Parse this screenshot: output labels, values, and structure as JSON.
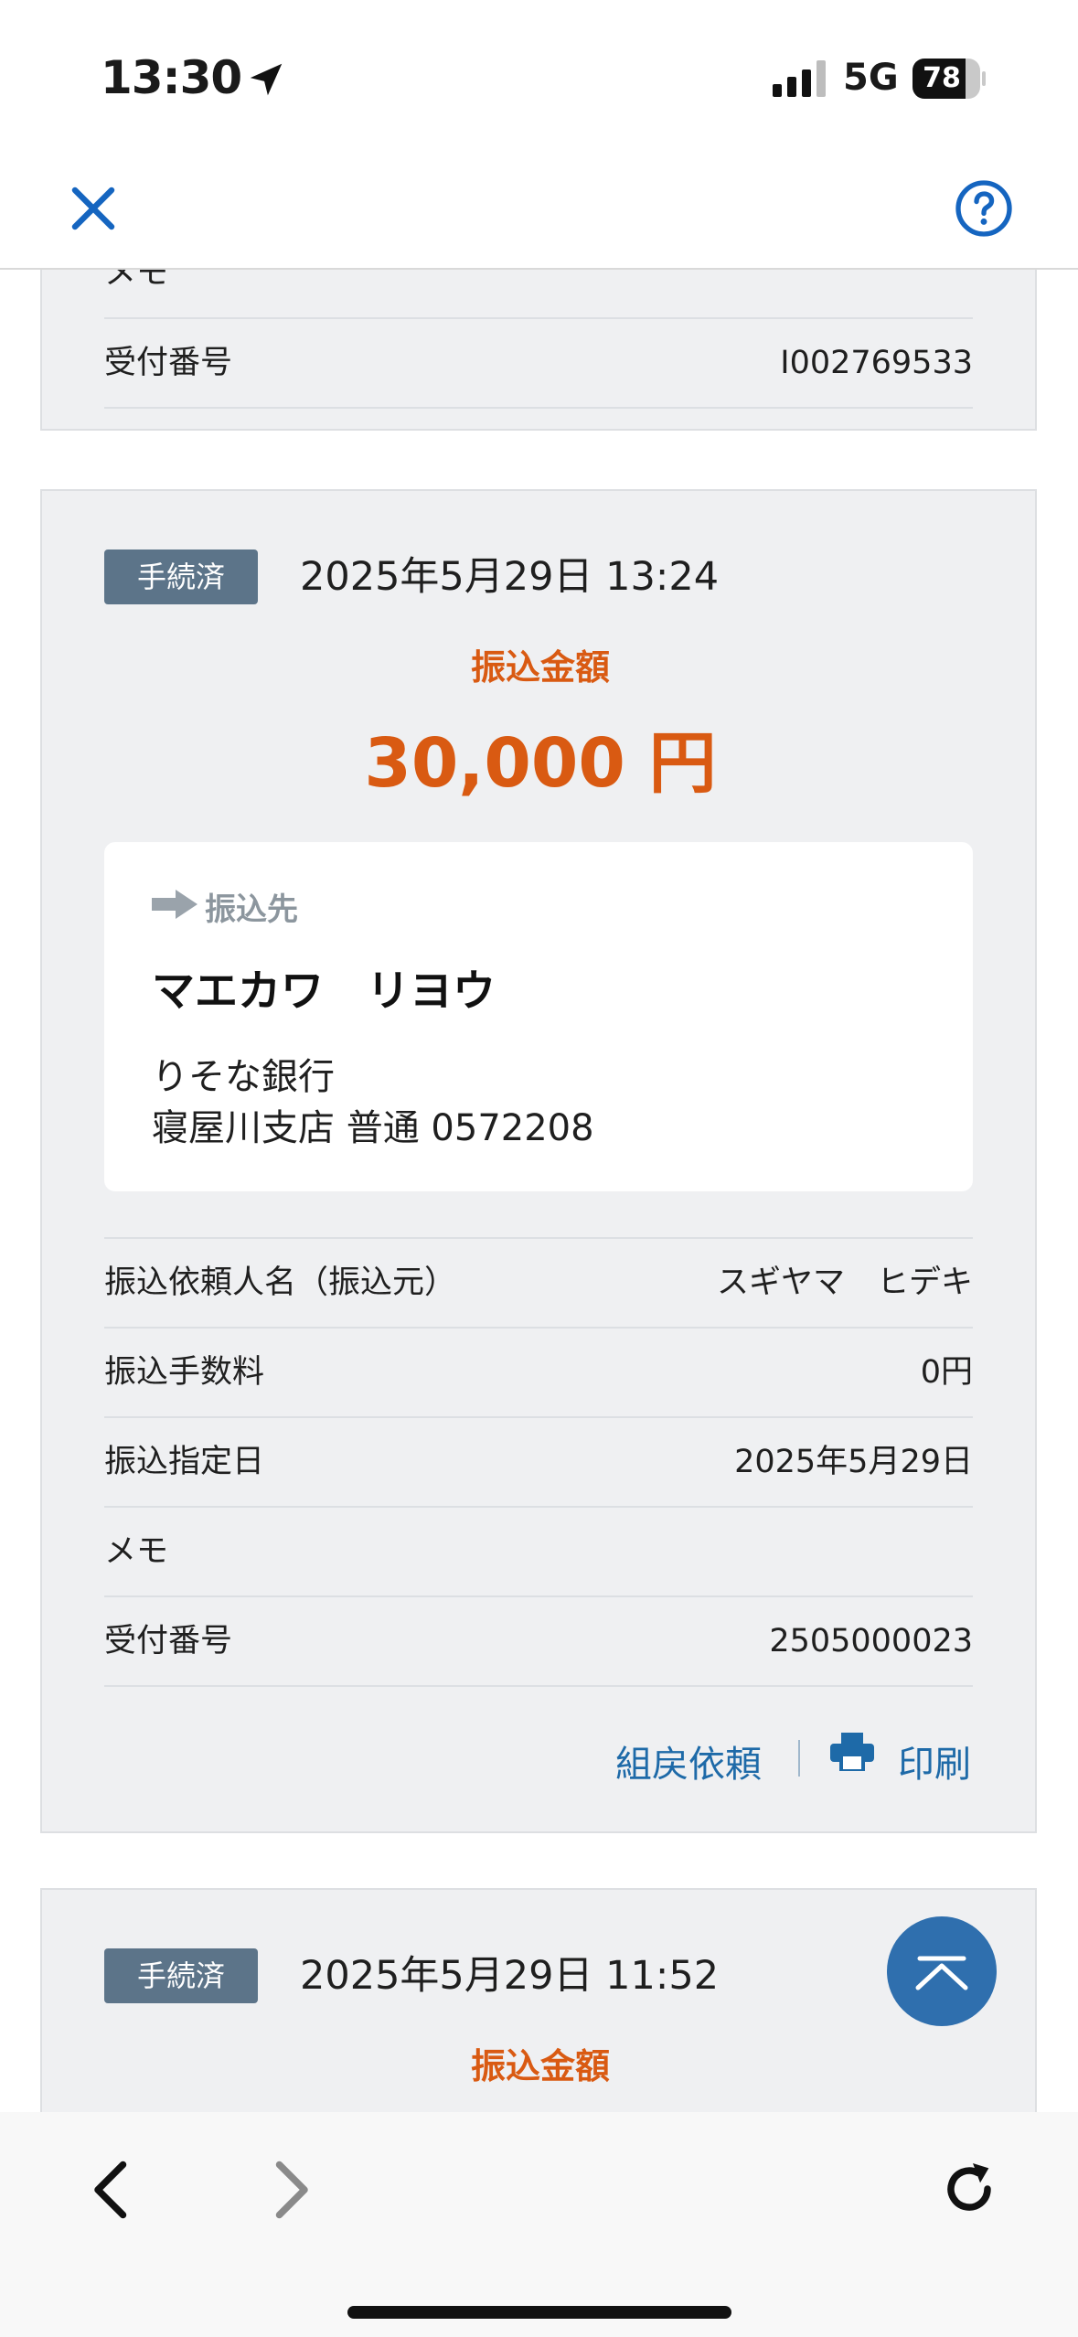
{
  "status_bar": {
    "time": "13:30",
    "network": "5G",
    "battery_percent": 78,
    "battery_label": "78",
    "location_icon": "location-arrow-icon",
    "signal_icon": "signal-bars-icon"
  },
  "header": {
    "close_icon": "close-icon",
    "help_icon": "help-circle-icon",
    "accent_color": "#1565c0"
  },
  "top_card": {
    "partial_label": "メモ",
    "receipt_label": "受付番号",
    "receipt_value": "I002769533"
  },
  "transfer_card": {
    "status_badge": "手続済",
    "datetime": "2025年5月29日 13:24",
    "amount_label": "振込金額",
    "amount": "30,000 円",
    "destination": {
      "label": "振込先",
      "name": "マエカワ　リヨウ",
      "bank": "りそな銀行",
      "branch_account": "寝屋川支店 普通 0572208"
    },
    "details": [
      {
        "label": "振込依頼人名（振込元）",
        "value": "スギヤマ　ヒデキ"
      },
      {
        "label": "振込手数料",
        "value": "0円"
      },
      {
        "label": "振込指定日",
        "value": "2025年5月29日"
      },
      {
        "label": "メモ",
        "value": ""
      },
      {
        "label": "受付番号",
        "value": "2505000023"
      }
    ],
    "actions": {
      "reassemble": "組戻依頼",
      "print": "印刷"
    }
  },
  "next_card": {
    "status_badge": "手続済",
    "datetime": "2025年5月29日 11:52",
    "amount_label": "振込金額"
  },
  "scroll_top_icon": "chevron-up-icon",
  "toolbar": {
    "back_icon": "chevron-left-icon",
    "forward_icon": "chevron-right-icon",
    "reload_icon": "reload-icon"
  },
  "colors": {
    "amount": "#d95a12",
    "badge": "#5c7489",
    "link": "#1e6aa8",
    "card_bg": "#eff0f2"
  }
}
